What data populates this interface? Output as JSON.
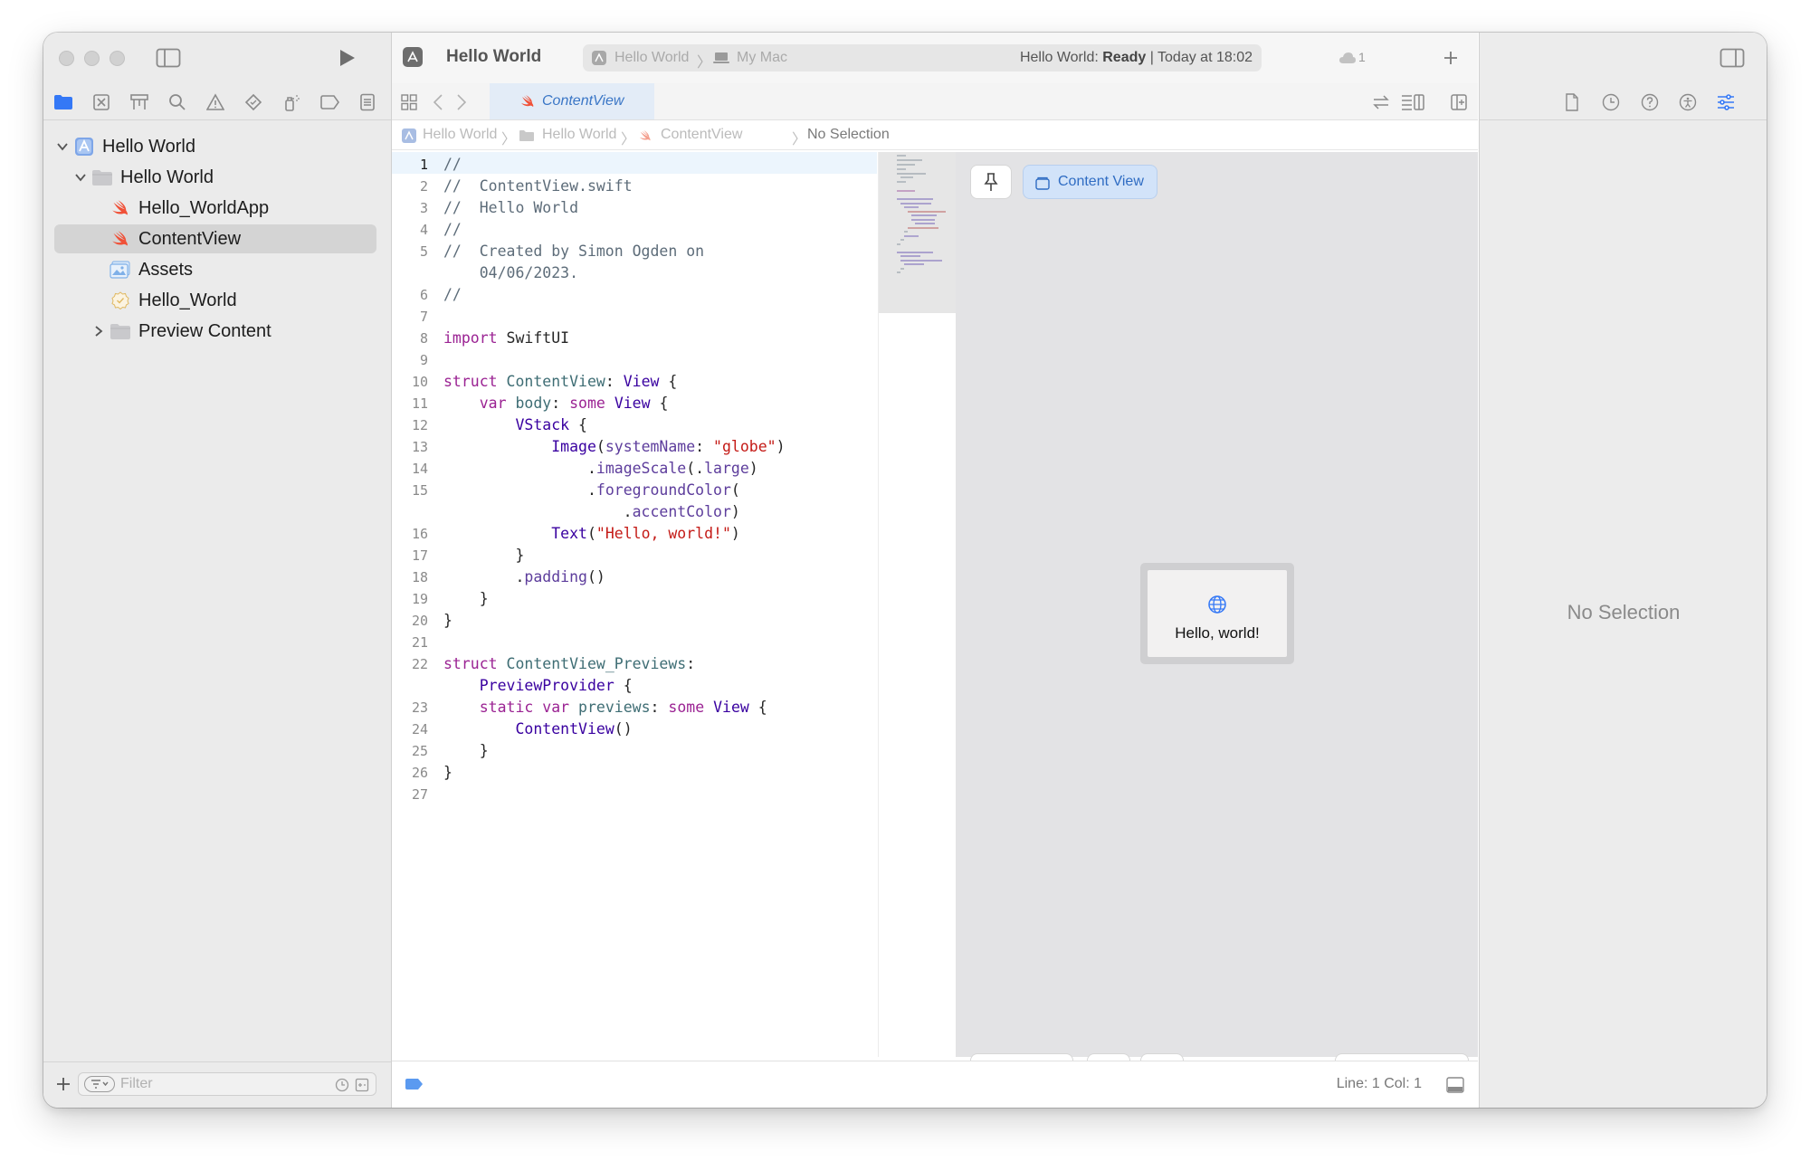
{
  "window": {
    "app_title": "Hello World",
    "activity": {
      "scheme": "Hello World",
      "destination": "My Mac",
      "status_prefix": "Hello World: ",
      "status_state": "Ready",
      "status_suffix": " | Today at 18:02",
      "issue_count": "1"
    }
  },
  "navigator": {
    "items": [
      {
        "label": "Hello World",
        "icon": "project-icon",
        "disclosure": "expanded",
        "level": 0,
        "selected": false
      },
      {
        "label": "Hello World",
        "icon": "folder-icon",
        "disclosure": "expanded",
        "level": 1,
        "selected": false
      },
      {
        "label": "Hello_WorldApp",
        "icon": "swift-file-icon",
        "disclosure": "none",
        "level": 2,
        "selected": false
      },
      {
        "label": "ContentView",
        "icon": "swift-file-icon",
        "disclosure": "none",
        "level": 2,
        "selected": true
      },
      {
        "label": "Assets",
        "icon": "asset-catalog-icon",
        "disclosure": "none",
        "level": 2,
        "selected": false
      },
      {
        "label": "Hello_World",
        "icon": "entitlements-icon",
        "disclosure": "none",
        "level": 2,
        "selected": false
      },
      {
        "label": "Preview Content",
        "icon": "folder-icon",
        "disclosure": "collapsed",
        "level": 2,
        "selected": false
      }
    ],
    "filter_placeholder": "Filter"
  },
  "editor": {
    "tab_label": "ContentView",
    "jump_bar": [
      "Hello World",
      "Hello World",
      "ContentView",
      "No Selection"
    ],
    "current_line": 1,
    "code_lines": [
      {
        "n": "1",
        "html": "<span class=\"cm\">//</span>"
      },
      {
        "n": "2",
        "html": "<span class=\"cm\">//  ContentView.swift</span>"
      },
      {
        "n": "3",
        "html": "<span class=\"cm\">//  Hello World</span>"
      },
      {
        "n": "4",
        "html": "<span class=\"cm\">//</span>"
      },
      {
        "n": "5",
        "html": "<span class=\"cm\">//  Created by Simon Ogden on</span>"
      },
      {
        "n": "",
        "html": "<span class=\"cm\">    04/06/2023.</span>"
      },
      {
        "n": "6",
        "html": "<span class=\"cm\">//</span>"
      },
      {
        "n": "7",
        "html": ""
      },
      {
        "n": "8",
        "html": "<span class=\"kw\">import</span> SwiftUI"
      },
      {
        "n": "9",
        "html": ""
      },
      {
        "n": "10",
        "html": "<span class=\"kw\">struct</span> <span class=\"mn\">ContentView</span>: <span class=\"ty\">View</span> {"
      },
      {
        "n": "11",
        "html": "    <span class=\"kw\">var</span> <span class=\"mn\">body</span>: <span class=\"kw\">some</span> <span class=\"ty\">View</span> {"
      },
      {
        "n": "12",
        "html": "        <span class=\"ty\">VStack</span> {"
      },
      {
        "n": "13",
        "html": "            <span class=\"ty\">Image</span>(<span class=\"fn\">systemName</span>: <span class=\"str\">\"globe\"</span>)"
      },
      {
        "n": "14",
        "html": "                .<span class=\"fn\">imageScale</span>(.<span class=\"fn\">large</span>)"
      },
      {
        "n": "15",
        "html": "                .<span class=\"fn\">foregroundColor</span>("
      },
      {
        "n": "",
        "html": "                    .<span class=\"fn\">accentColor</span>)"
      },
      {
        "n": "16",
        "html": "            <span class=\"ty\">Text</span>(<span class=\"str\">\"Hello, world!\"</span>)"
      },
      {
        "n": "17",
        "html": "        }"
      },
      {
        "n": "18",
        "html": "        .<span class=\"fn\">padding</span>()"
      },
      {
        "n": "19",
        "html": "    }"
      },
      {
        "n": "20",
        "html": "}"
      },
      {
        "n": "21",
        "html": ""
      },
      {
        "n": "22",
        "html": "<span class=\"kw\">struct</span> <span class=\"mn\">ContentView_Previews</span>:"
      },
      {
        "n": "",
        "html": "    <span class=\"ty\">PreviewProvider</span> {"
      },
      {
        "n": "23",
        "html": "    <span class=\"kw\">static</span> <span class=\"kw\">var</span> <span class=\"mn\">previews</span>: <span class=\"kw\">some</span> <span class=\"ty\">View</span> {"
      },
      {
        "n": "24",
        "html": "        <span class=\"ty\">ContentView</span>()"
      },
      {
        "n": "25",
        "html": "    }"
      },
      {
        "n": "26",
        "html": "}"
      },
      {
        "n": "27",
        "html": ""
      }
    ],
    "status_position": "Line: 1  Col: 1"
  },
  "canvas": {
    "preview_button_label": "Content View",
    "preview_text": "Hello, world!"
  },
  "inspector": {
    "empty_state": "No Selection"
  },
  "colors": {
    "accent": "#3478f6",
    "swift_orange": "#f05138",
    "selection": "#d4d4d4"
  }
}
